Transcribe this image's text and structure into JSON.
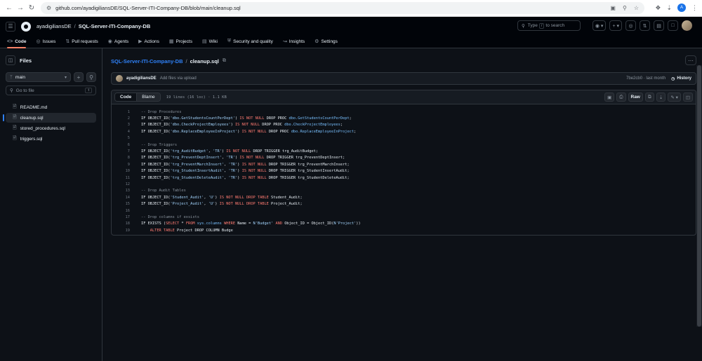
{
  "browser": {
    "url": "github.com/ayadigiliansDE/SQL-Server-ITI-Company-DB/blob/main/cleanup.sql",
    "profile_initial": "A"
  },
  "header": {
    "owner": "ayadigiliansDE",
    "repo": "SQL-Server-ITI-Company-DB",
    "search_prefix": "Type",
    "search_key": "/",
    "search_suffix": "to search"
  },
  "repo_nav": {
    "tabs": [
      {
        "label": "Code",
        "icon": "code-icon"
      },
      {
        "label": "Issues",
        "icon": "issue-icon"
      },
      {
        "label": "Pull requests",
        "icon": "pull-request-icon"
      },
      {
        "label": "Agents",
        "icon": "agents-icon"
      },
      {
        "label": "Actions",
        "icon": "actions-icon"
      },
      {
        "label": "Projects",
        "icon": "projects-icon"
      },
      {
        "label": "Wiki",
        "icon": "wiki-icon"
      },
      {
        "label": "Security and quality",
        "icon": "shield-icon"
      },
      {
        "label": "Insights",
        "icon": "graph-icon"
      },
      {
        "label": "Settings",
        "icon": "gear-icon"
      }
    ]
  },
  "sidebar": {
    "title": "Files",
    "branch": "main",
    "goto_placeholder": "Go to file",
    "goto_key": "t",
    "files": [
      "README.md",
      "cleanup.sql",
      "stored_procedures.sql",
      "triggers.sql"
    ]
  },
  "file": {
    "repo": "SQL-Server-ITI-Company-DB",
    "name": "cleanup.sql"
  },
  "commit": {
    "author": "ayadigiliansDE",
    "message": "Add files via upload",
    "sha_time": "7be2cb0 · last month",
    "history_label": "History"
  },
  "code_view": {
    "code_tab": "Code",
    "blame_tab": "Blame",
    "meta": "19 lines (16 loc) · 1.1 KB",
    "raw_label": "Raw",
    "lines": [
      [
        [
          "cm",
          "-- Drop Procedures"
        ]
      ],
      [
        [
          "ct",
          "IF OBJECT_ID("
        ],
        [
          "st",
          "'dbo.GetStudentsCountPerDept'"
        ],
        [
          "ct",
          ") "
        ],
        [
          "kw",
          "IS NOT NULL"
        ],
        [
          "ct",
          " DROP PROC "
        ],
        [
          "ob",
          "dbo.GetStudentsCountPerDept"
        ],
        [
          "ct",
          ";"
        ]
      ],
      [
        [
          "ct",
          "IF OBJECT_ID("
        ],
        [
          "st",
          "'dbo.CheckProjectEmployees'"
        ],
        [
          "ct",
          ") "
        ],
        [
          "kw",
          "IS NOT NULL"
        ],
        [
          "ct",
          " DROP PROC "
        ],
        [
          "ob",
          "dbo.CheckProjectEmployees"
        ],
        [
          "ct",
          ";"
        ]
      ],
      [
        [
          "ct",
          "IF OBJECT_ID("
        ],
        [
          "st",
          "'dbo.ReplaceEmployeeInProject'"
        ],
        [
          "ct",
          ") "
        ],
        [
          "kw",
          "IS NOT NULL"
        ],
        [
          "ct",
          " DROP PROC "
        ],
        [
          "ob",
          "dbo.ReplaceEmployeeInProject"
        ],
        [
          "ct",
          ";"
        ]
      ],
      [],
      [
        [
          "cm",
          "-- Drop Triggers"
        ]
      ],
      [
        [
          "ct",
          "IF OBJECT_ID("
        ],
        [
          "st",
          "'trg_AuditBudget'"
        ],
        [
          "ct",
          ", "
        ],
        [
          "st",
          "'TR'"
        ],
        [
          "ct",
          ") "
        ],
        [
          "kw",
          "IS NOT NULL"
        ],
        [
          "ct",
          " DROP TRIGGER trg_AuditBudget;"
        ]
      ],
      [
        [
          "ct",
          "IF OBJECT_ID("
        ],
        [
          "st",
          "'trg_PreventDeptInsert'"
        ],
        [
          "ct",
          ", "
        ],
        [
          "st",
          "'TR'"
        ],
        [
          "ct",
          ") "
        ],
        [
          "kw",
          "IS NOT NULL"
        ],
        [
          "ct",
          " DROP TRIGGER trg_PreventDeptInsert;"
        ]
      ],
      [
        [
          "ct",
          "IF OBJECT_ID("
        ],
        [
          "st",
          "'trg_PreventMarchInsert'"
        ],
        [
          "ct",
          ", "
        ],
        [
          "st",
          "'TR'"
        ],
        [
          "ct",
          ") "
        ],
        [
          "kw",
          "IS NOT NULL"
        ],
        [
          "ct",
          " DROP TRIGGER trg_PreventMarchInsert;"
        ]
      ],
      [
        [
          "ct",
          "IF OBJECT_ID("
        ],
        [
          "st",
          "'trg_StudentInsertAudit'"
        ],
        [
          "ct",
          ", "
        ],
        [
          "st",
          "'TR'"
        ],
        [
          "ct",
          ") "
        ],
        [
          "kw",
          "IS NOT NULL"
        ],
        [
          "ct",
          " DROP TRIGGER trg_StudentInsertAudit;"
        ]
      ],
      [
        [
          "ct",
          "IF OBJECT_ID("
        ],
        [
          "st",
          "'trg_StudentDeleteAudit'"
        ],
        [
          "ct",
          ", "
        ],
        [
          "st",
          "'TR'"
        ],
        [
          "ct",
          ") "
        ],
        [
          "kw",
          "IS NOT NULL"
        ],
        [
          "ct",
          " DROP TRIGGER trg_StudentDeleteAudit;"
        ]
      ],
      [],
      [
        [
          "cm",
          "-- Drop Audit Tables"
        ]
      ],
      [
        [
          "ct",
          "IF OBJECT_ID("
        ],
        [
          "st",
          "'Student_Audit'"
        ],
        [
          "ct",
          ", "
        ],
        [
          "st",
          "'U'"
        ],
        [
          "ct",
          ") "
        ],
        [
          "kw",
          "IS NOT NULL DROP TABLE"
        ],
        [
          "ct",
          " Student_Audit;"
        ]
      ],
      [
        [
          "ct",
          "IF OBJECT_ID("
        ],
        [
          "st",
          "'Project_Audit'"
        ],
        [
          "ct",
          ", "
        ],
        [
          "st",
          "'U'"
        ],
        [
          "ct",
          ") "
        ],
        [
          "kw",
          "IS NOT NULL DROP TABLE"
        ],
        [
          "ct",
          " Project_Audit;"
        ]
      ],
      [],
      [
        [
          "cm",
          "-- Drop columns if exsists"
        ]
      ],
      [
        [
          "ct",
          "IF EXISTS ("
        ],
        [
          "kw",
          "SELECT"
        ],
        [
          "ct",
          " * "
        ],
        [
          "kw",
          "FROM"
        ],
        [
          "ct",
          " "
        ],
        [
          "ob",
          "sys.columns"
        ],
        [
          "ct",
          " "
        ],
        [
          "kw",
          "WHERE"
        ],
        [
          "ct",
          " Name = "
        ],
        [
          "st",
          "N'Budget'"
        ],
        [
          "ct",
          " "
        ],
        [
          "kw",
          "AND"
        ],
        [
          "ct",
          " Object_ID = Object_ID("
        ],
        [
          "st",
          "N'Project'"
        ],
        [
          "ct",
          "))"
        ]
      ],
      [
        [
          "ct",
          "    "
        ],
        [
          "kw",
          "ALTER TABLE"
        ],
        [
          "ct",
          " Project DROP COLUMN Budge"
        ]
      ]
    ]
  }
}
